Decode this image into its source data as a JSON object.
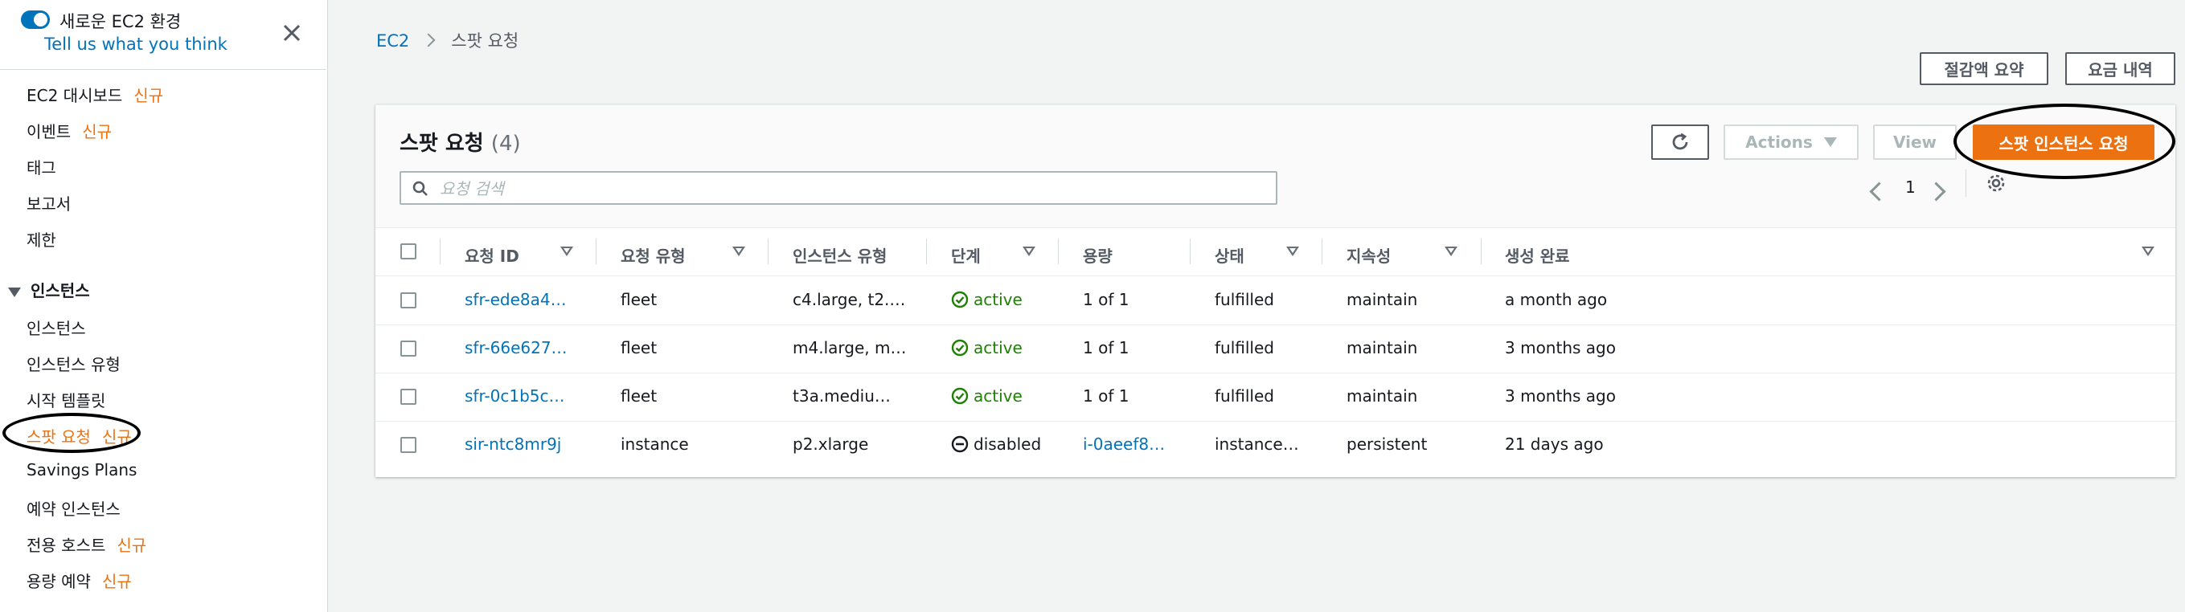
{
  "sidebar": {
    "toggle_label": "새로운 EC2 환경",
    "feedback_link": "Tell us what you think",
    "new_badge": "신규",
    "items_top": [
      {
        "label": "EC2 대시보드",
        "new": true
      },
      {
        "label": "이벤트",
        "new": true
      },
      {
        "label": "태그",
        "new": false
      },
      {
        "label": "보고서",
        "new": false
      },
      {
        "label": "제한",
        "new": false
      }
    ],
    "group_label": "인스턴스",
    "items_instances": [
      {
        "label": "인스턴스",
        "new": false
      },
      {
        "label": "인스턴스 유형",
        "new": false
      },
      {
        "label": "시작 템플릿",
        "new": false
      },
      {
        "label": "스팟 요청",
        "new": true,
        "active": true
      },
      {
        "label": "Savings Plans",
        "new": false
      },
      {
        "label": "예약 인스턴스",
        "new": false
      },
      {
        "label": "전용 호스트",
        "new": true
      },
      {
        "label": "용량 예약",
        "new": true
      }
    ]
  },
  "breadcrumb": {
    "root": "EC2",
    "current": "스팟 요청"
  },
  "top_buttons": {
    "savings_summary": "절감액 요약",
    "pricing_history": "요금 내역"
  },
  "panel": {
    "title": "스팟 요청",
    "count": "(4)",
    "actions_label": "Actions",
    "view_label": "View",
    "request_button": "스팟 인스턴스 요청",
    "search_placeholder": "요청 검색",
    "page_number": "1"
  },
  "table": {
    "columns": [
      "요청 ID",
      "요청 유형",
      "인스턴스 유형",
      "단계",
      "용량",
      "상태",
      "지속성",
      "생성 완료"
    ],
    "rows": [
      {
        "id": "sfr-ede8a4…",
        "type": "fleet",
        "instance_type": "c4.large, t2.…",
        "phase": "active",
        "phase_status": "active",
        "capacity": "1 of 1",
        "capacity_link": false,
        "state": "fulfilled",
        "persistence": "maintain",
        "created": "a month ago"
      },
      {
        "id": "sfr-66e627…",
        "type": "fleet",
        "instance_type": "m4.large, m…",
        "phase": "active",
        "phase_status": "active",
        "capacity": "1 of 1",
        "capacity_link": false,
        "state": "fulfilled",
        "persistence": "maintain",
        "created": "3 months ago"
      },
      {
        "id": "sfr-0c1b5c…",
        "type": "fleet",
        "instance_type": "t3a.mediu…",
        "phase": "active",
        "phase_status": "active",
        "capacity": "1 of 1",
        "capacity_link": false,
        "state": "fulfilled",
        "persistence": "maintain",
        "created": "3 months ago"
      },
      {
        "id": "sir-ntc8mr9j",
        "type": "instance",
        "instance_type": "p2.xlarge",
        "phase": "disabled",
        "phase_status": "disabled",
        "capacity": "i-0aeef8…",
        "capacity_link": true,
        "state": "instance…",
        "persistence": "persistent",
        "created": "21 days ago"
      }
    ]
  },
  "colors": {
    "accent": "#ec7211",
    "link": "#0073bb",
    "success": "#1d8102"
  }
}
